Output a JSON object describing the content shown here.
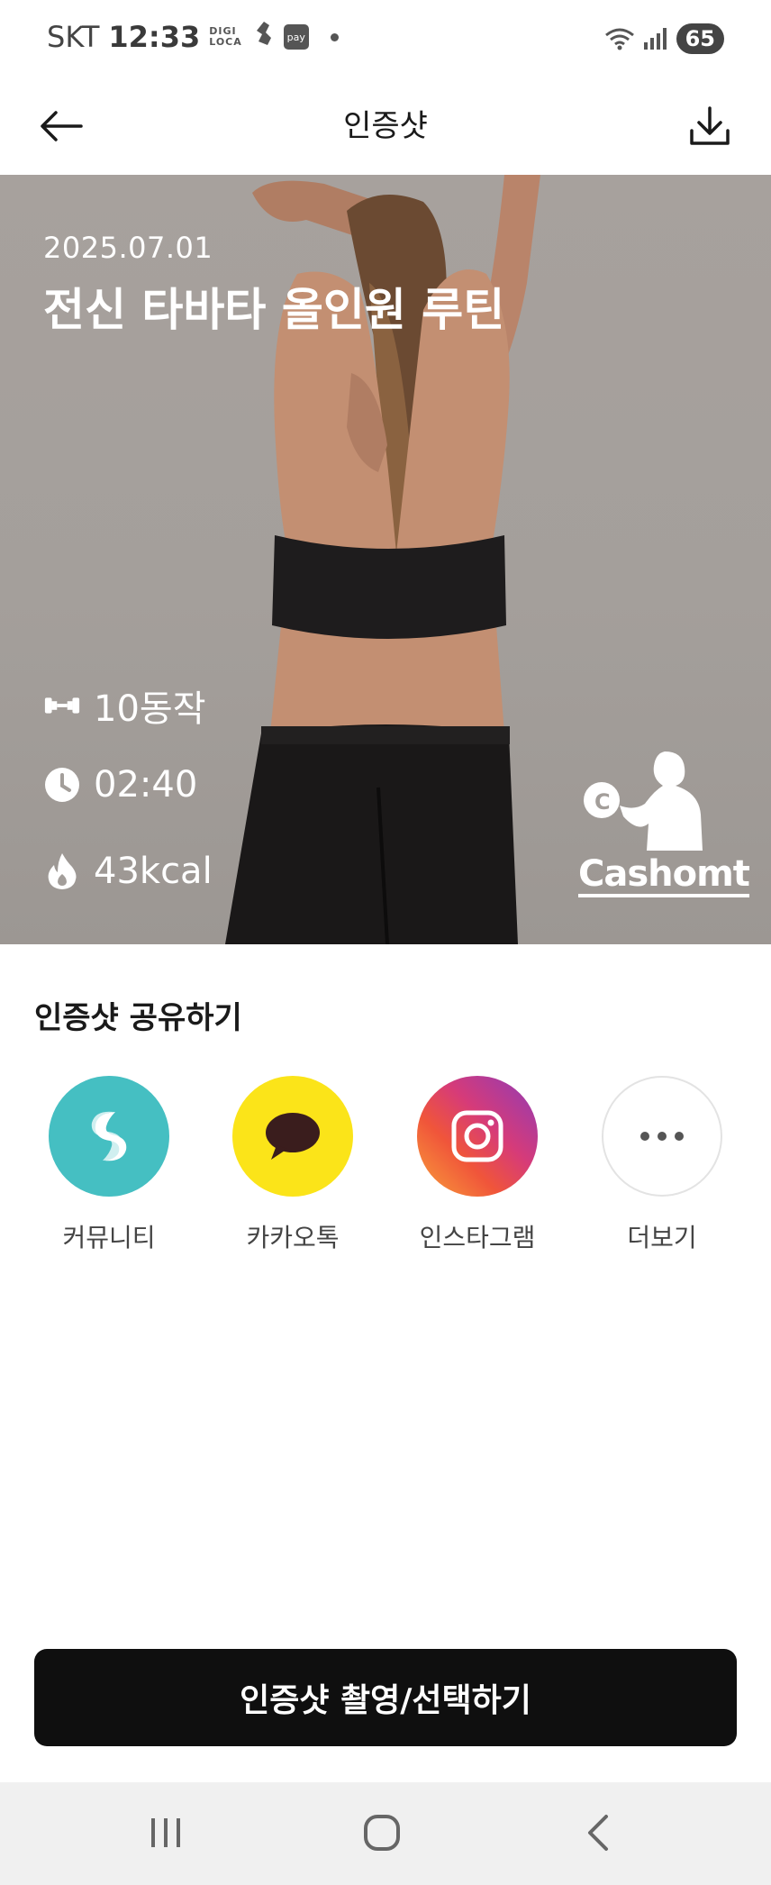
{
  "status_bar": {
    "carrier": "SKT",
    "time": "12:33",
    "app_logo_1": "DIGI LOCA",
    "app_icon_2": "pay",
    "battery": "65"
  },
  "header": {
    "title": "인증샷"
  },
  "hero": {
    "date": "2025.07.01",
    "routine_name": "전신 타바타 올인원 루틴",
    "moves": "10동작",
    "duration": "02:40",
    "calories": "43kcal",
    "brand_logo": "Cashomt",
    "brand_badge": "C"
  },
  "share": {
    "title": "인증샷 공유하기",
    "items": [
      {
        "label": "커뮤니티",
        "icon": "community-icon",
        "color": "#45bfc2"
      },
      {
        "label": "카카오톡",
        "icon": "kakaotalk-icon",
        "color": "#fbe419"
      },
      {
        "label": "인스타그램",
        "icon": "instagram-icon",
        "color": "#d63b79"
      },
      {
        "label": "더보기",
        "icon": "more-icon",
        "color": "#ffffff"
      }
    ]
  },
  "primary_button": {
    "label": "인증샷 촬영/선택하기"
  },
  "nav": {
    "recents_icon": "recents-icon",
    "home_icon": "home-icon",
    "back_icon": "back-icon"
  }
}
